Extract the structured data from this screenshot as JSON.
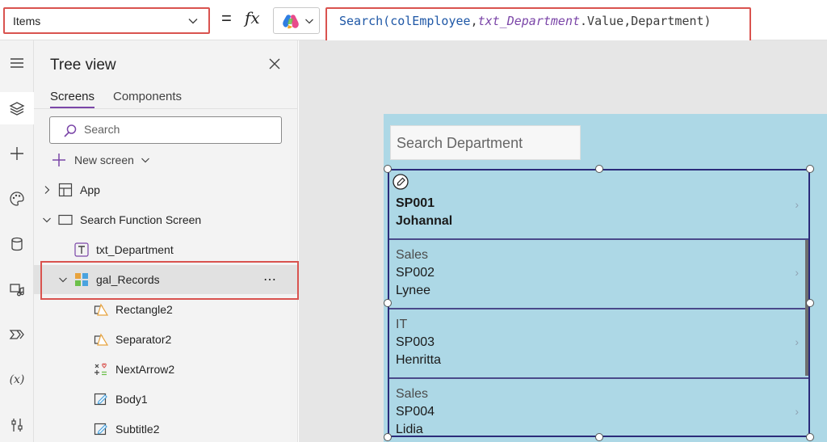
{
  "formula_bar": {
    "property": "Items",
    "equals": "=",
    "fx": "fx",
    "formula_tokens": [
      {
        "text": "Search(",
        "kind": "fn"
      },
      {
        "text": "colEmployee",
        "kind": "var"
      },
      {
        "text": ",",
        "kind": "plain"
      },
      {
        "text": "txt_Department",
        "kind": "ctrl"
      },
      {
        "text": ".Value,Department)",
        "kind": "plain"
      }
    ]
  },
  "tree_view": {
    "title": "Tree view",
    "tabs": [
      "Screens",
      "Components"
    ],
    "search_placeholder": "Search",
    "new_screen_label": "New screen",
    "app_label": "App",
    "screen_label": "Search Function Screen",
    "items": [
      {
        "label": "txt_Department",
        "icon": "text-input-icon"
      },
      {
        "label": "gal_Records",
        "icon": "gallery-icon"
      },
      {
        "label": "Rectangle2",
        "icon": "shape-icon"
      },
      {
        "label": "Separator2",
        "icon": "shape-icon"
      },
      {
        "label": "NextArrow2",
        "icon": "icons-icon"
      },
      {
        "label": "Body1",
        "icon": "label-edit-icon"
      },
      {
        "label": "Subtitle2",
        "icon": "label-edit-icon"
      }
    ],
    "more_label": "⋯"
  },
  "canvas": {
    "search_placeholder": "Search Department",
    "gallery_items": [
      {
        "title": "",
        "subtitle": "SP001",
        "body": "Johannal",
        "arrow": "›"
      },
      {
        "title": "Sales",
        "subtitle": "SP002",
        "body": "Lynee",
        "arrow": "›"
      },
      {
        "title": "IT",
        "subtitle": "SP003",
        "body": "Henritta",
        "arrow": "›"
      },
      {
        "title": "Sales",
        "subtitle": "SP004",
        "body": "Lidia",
        "arrow": "›"
      }
    ]
  },
  "colors": {
    "accent": "#7b46a8",
    "highlight": "#d9534f",
    "screen_bg": "#add8e6"
  }
}
